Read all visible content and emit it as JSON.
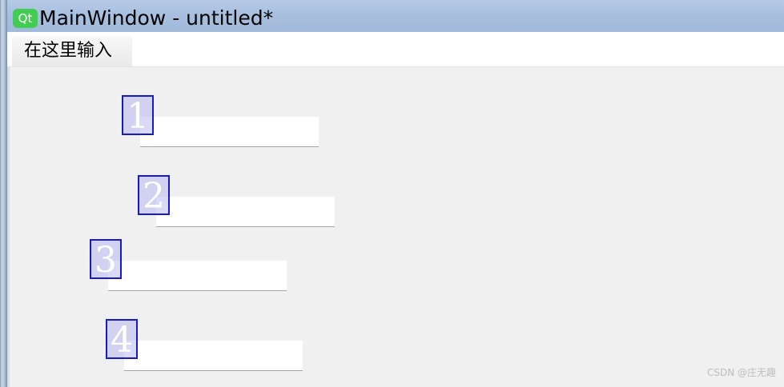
{
  "window": {
    "logo_text": "Qt",
    "title": "MainWindow - untitled*"
  },
  "menubar": {
    "placeholder_item": "在这里输入"
  },
  "fields": [
    {
      "marker": "1",
      "value": ""
    },
    {
      "marker": "2",
      "value": ""
    },
    {
      "marker": "3",
      "value": ""
    },
    {
      "marker": "4",
      "value": ""
    }
  ],
  "watermark": "CSDN @庄无趣",
  "colors": {
    "titlebar": "#a8bfdf",
    "qt_green": "#41cd52",
    "marker_border": "#1818cc",
    "marker_fill": "#aaaaf0",
    "form_bg": "#f0f0f0"
  }
}
